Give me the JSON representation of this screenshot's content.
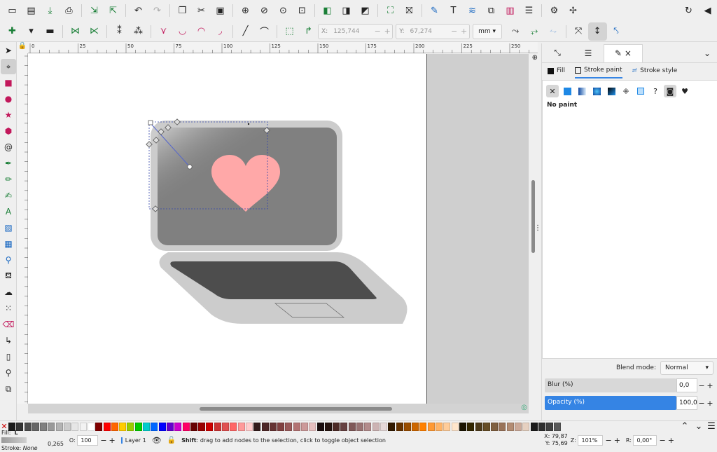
{
  "command_bar": {
    "icons": [
      "new-document-icon",
      "open-icon",
      "save-icon",
      "print-icon",
      "sep",
      "import-icon",
      "export-icon",
      "sep",
      "undo-icon",
      "redo-icon",
      "sep",
      "copy-icon",
      "cut-icon",
      "paste-icon",
      "sep",
      "zoom-selection-icon",
      "zoom-drawing-icon",
      "zoom-page-icon",
      "zoom-1-1-icon",
      "sep",
      "duplicate-icon",
      "clone-icon",
      "unlink-clone-icon",
      "sep",
      "group-icon",
      "ungroup-icon",
      "sep",
      "fill-stroke-icon",
      "text-font-icon",
      "layers-icon",
      "xml-editor-icon",
      "document-properties-icon",
      "align-distribute-icon",
      "sep",
      "preferences-icon",
      "transform-icon"
    ],
    "right_icons": [
      "snap-toggle-icon",
      "collapse-arrow-icon"
    ]
  },
  "control_bar": {
    "x": {
      "label": "X:",
      "value": "125,744"
    },
    "y": {
      "label": "Y:",
      "value": "67,274"
    },
    "unit": "mm"
  },
  "ruler": {
    "top_ticks": [
      "0",
      "25",
      "50",
      "75",
      "100",
      "125",
      "150",
      "175",
      "200",
      "225",
      "250"
    ]
  },
  "dialog": {
    "close": "×",
    "subtabs": [
      {
        "label": "Fill"
      },
      {
        "label": "Stroke paint"
      },
      {
        "label": "Stroke style"
      }
    ],
    "paint_mode": "No paint",
    "blend": {
      "label": "Blend mode:",
      "value": "Normal"
    },
    "blur": {
      "label": "Blur (%)",
      "value": "0,0",
      "fraction": 0.0
    },
    "opacity": {
      "label": "Opacity (%)",
      "value": "100,0",
      "fraction": 1.0
    }
  },
  "palette": [
    "#1a1a1a",
    "#333333",
    "#4d4d4d",
    "#666666",
    "#808080",
    "#999999",
    "#b3b3b3",
    "#cccccc",
    "#e6e6e6",
    "#f2f2f2",
    "#ffffff",
    "#800000",
    "#ff0000",
    "#ff6600",
    "#ffcc00",
    "#99cc00",
    "#00cc00",
    "#00cccc",
    "#0066ff",
    "#0000ff",
    "#6600cc",
    "#cc00cc",
    "#ff0066",
    "#660000",
    "#990000",
    "#cc0000",
    "#cc3333",
    "#e05050",
    "#ff6666",
    "#ff9999",
    "#ffcccc",
    "#331a1a",
    "#4d2626",
    "#663333",
    "#804040",
    "#995959",
    "#b37373",
    "#cc9999",
    "#e6bfbf",
    "#1a0d0d",
    "#26140f",
    "#4d2b26",
    "#664040",
    "#805959",
    "#997373",
    "#b38c8c",
    "#ccb3b3",
    "#e6d9d9",
    "#331a00",
    "#663300",
    "#994d00",
    "#cc6600",
    "#ff8000",
    "#ff9933",
    "#ffb366",
    "#ffcc99",
    "#ffe6cc",
    "#1a1300",
    "#332600",
    "#4d3a1a",
    "#664d26",
    "#806040",
    "#997359",
    "#b38c73",
    "#ccaa99",
    "#e6d0c0",
    "#1a1a1a",
    "#2e2e2e",
    "#404040",
    "#595959"
  ],
  "status": {
    "fill_label": "Fill:",
    "fill_value": "L",
    "stroke_label": "Stroke:",
    "stroke_value": "None",
    "stroke_width": "0,265",
    "opacity_label": "O:",
    "opacity_value": "100",
    "layer": "Layer 1",
    "message_bold": "Shift",
    "message": ": drag to add nodes to the selection, click to toggle object selection",
    "coord_x_label": "X:",
    "coord_x": "79,87",
    "coord_y_label": "Y:",
    "coord_y": "75,69",
    "zoom_label": "Z:",
    "zoom": "101%",
    "rotate_label": "R:",
    "rotate": "0,00°"
  }
}
